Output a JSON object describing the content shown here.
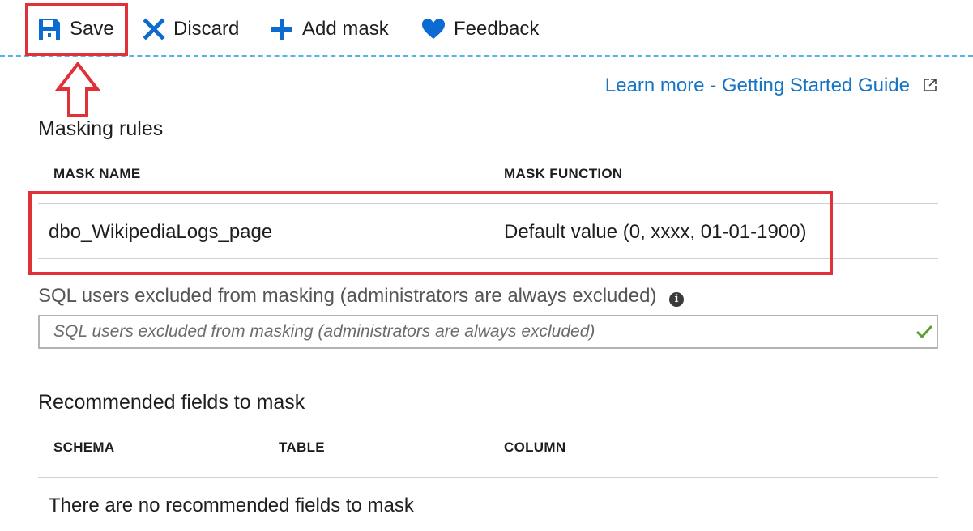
{
  "toolbar": {
    "save_label": "Save",
    "discard_label": "Discard",
    "add_mask_label": "Add mask",
    "feedback_label": "Feedback"
  },
  "learn_more_link": "Learn more - Getting Started Guide",
  "masking_rules": {
    "title": "Masking rules",
    "columns": [
      "MASK NAME",
      "MASK FUNCTION"
    ],
    "rows": [
      {
        "mask_name": "dbo_WikipediaLogs_page",
        "mask_function": "Default value (0, xxxx, 01-01-1900)"
      }
    ]
  },
  "excluded_users": {
    "label": "SQL users excluded from masking (administrators are always excluded)",
    "placeholder": "SQL users excluded from masking (administrators are always excluded)",
    "value": ""
  },
  "recommended": {
    "title": "Recommended fields to mask",
    "columns": [
      "SCHEMA",
      "TABLE",
      "COLUMN"
    ],
    "empty_message": "There are no recommended fields to mask"
  },
  "colors": {
    "accent_blue": "#1574c4",
    "icon_blue": "#0b6bd1",
    "annotation_red": "#e03038",
    "valid_green": "#5aa02c"
  },
  "icons": {
    "save": "save-icon",
    "discard": "close-icon",
    "add_mask": "plus-icon",
    "feedback": "heart-icon",
    "external_link": "external-link-icon",
    "info": "info-icon",
    "valid": "checkmark-icon",
    "annotation_arrow": "up-arrow-annotation"
  }
}
